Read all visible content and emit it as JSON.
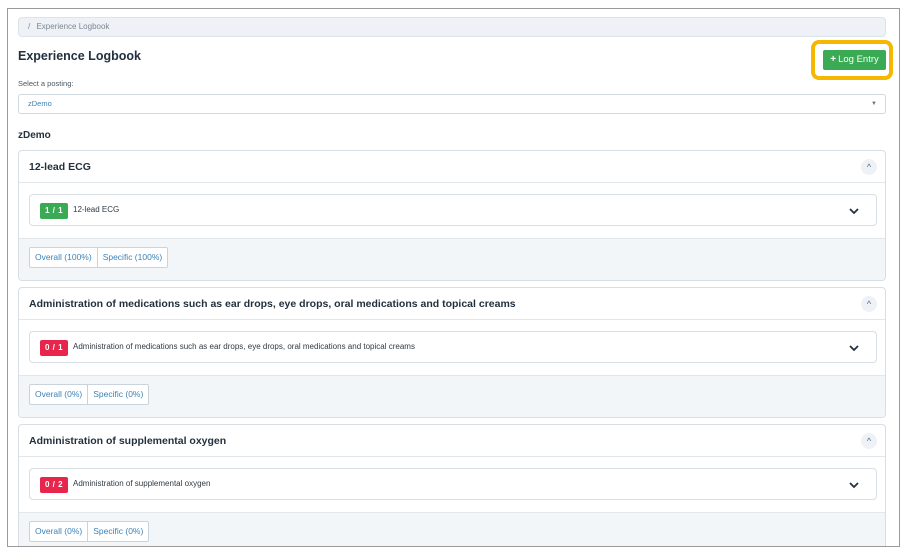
{
  "breadcrumb": {
    "separator": "/",
    "label": "Experience Logbook"
  },
  "page": {
    "title": "Experience Logbook"
  },
  "toolbar": {
    "log_entry_label": "Log Entry",
    "log_entry_icon": "plus-icon"
  },
  "posting": {
    "select_label": "Select a posting:",
    "selected_value": "zDemo",
    "heading": "zDemo"
  },
  "colors": {
    "success": "#3aaa54",
    "danger": "#e8264b",
    "highlight": "#f6b700",
    "link": "#3b82b7"
  },
  "cards": [
    {
      "title": "12-lead ECG",
      "item": {
        "count": "1 / 1",
        "status": "complete",
        "label": "12-lead ECG"
      },
      "overall": "Overall (100%)",
      "specific": "Specific (100%)"
    },
    {
      "title": "Administration of medications such as ear drops, eye drops, oral medications and topical creams",
      "item": {
        "count": "0 / 1",
        "status": "incomplete",
        "label": "Administration of medications such as ear drops, eye drops, oral medications and topical creams"
      },
      "overall": "Overall (0%)",
      "specific": "Specific (0%)"
    },
    {
      "title": "Administration of supplemental oxygen",
      "item": {
        "count": "0 / 2",
        "status": "incomplete",
        "label": "Administration of supplemental oxygen"
      },
      "overall": "Overall (0%)",
      "specific": "Specific (0%)"
    }
  ]
}
